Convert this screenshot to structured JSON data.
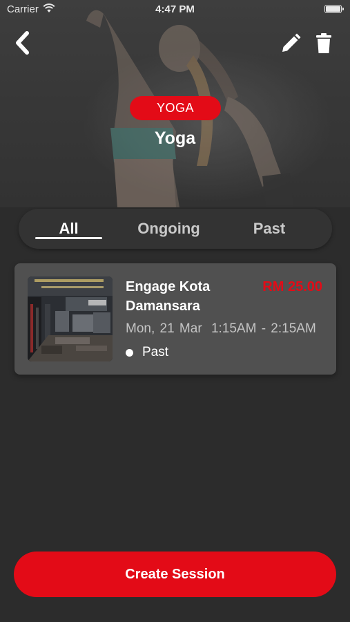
{
  "status_bar": {
    "carrier": "Carrier",
    "time": "4:47 PM",
    "battery_level": 1.0
  },
  "header": {
    "back_icon": "chevron-left-icon",
    "edit_icon": "pencil-icon",
    "delete_icon": "trash-icon"
  },
  "hero": {
    "tag": "YOGA",
    "title": "Yoga"
  },
  "tabs": {
    "items": [
      {
        "label": "All",
        "active": true
      },
      {
        "label": "Ongoing",
        "active": false
      },
      {
        "label": "Past",
        "active": false
      }
    ]
  },
  "sessions": [
    {
      "title": "Engage Kota Damansara",
      "price": "RM 25.00",
      "date": "Mon, 21 Mar",
      "time": "1:15AM - 2:15AM",
      "status": "Past"
    }
  ],
  "create_button": {
    "label": "Create Session"
  },
  "colors": {
    "accent": "#e30b17",
    "background": "#2c2c2c",
    "card": "#505050",
    "tab_bar": "#333333"
  }
}
